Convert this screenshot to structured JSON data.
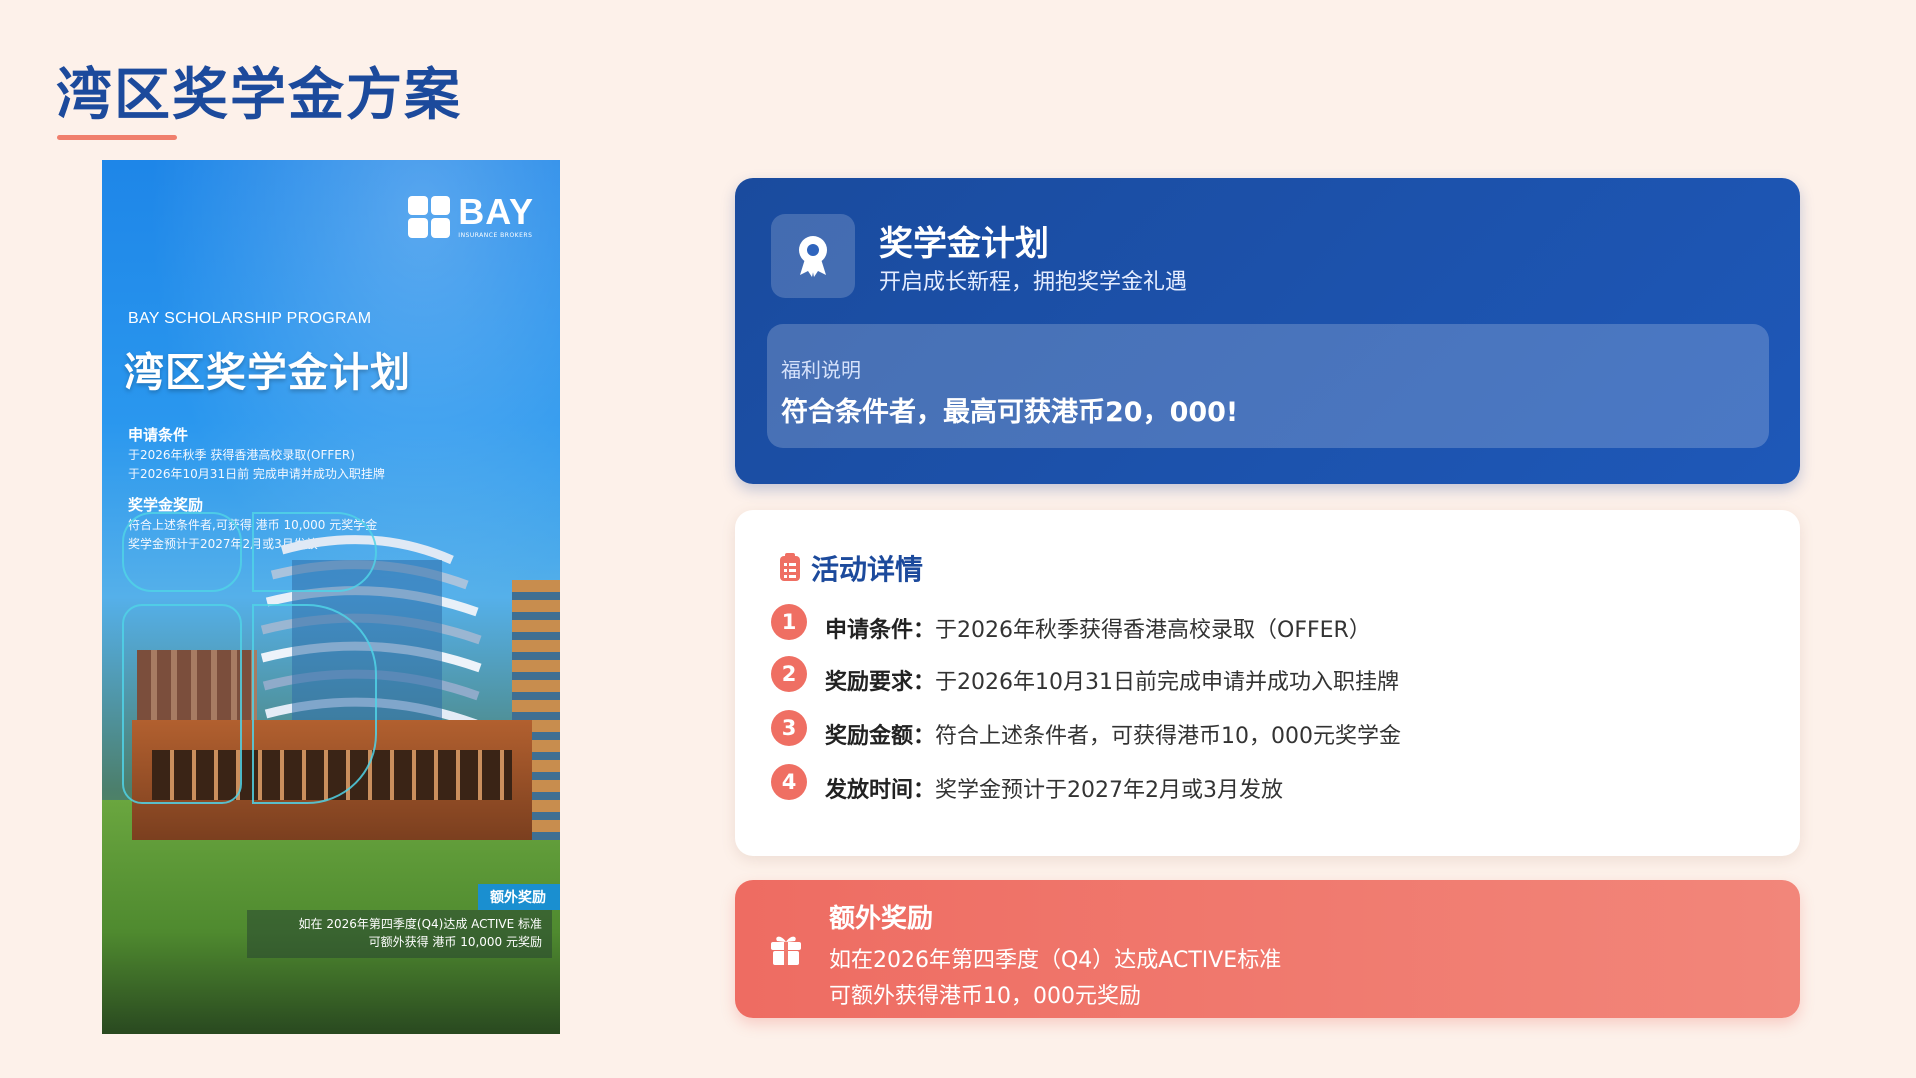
{
  "page": {
    "title": "湾区奖学金方案"
  },
  "poster": {
    "logo_name": "BAY",
    "logo_sub": "INSURANCE BROKERS",
    "en_title": "BAY SCHOLARSHIP PROGRAM",
    "cn_title": "湾区奖学金计划",
    "conditions_title": "申请条件",
    "conditions": [
      "于2026年秋季 获得香港高校录取(OFFER)",
      "于2026年10月31日前 完成申请并成功入职挂牌"
    ],
    "award_title": "奖学金奖励",
    "award_lines": [
      "符合上述条件者,可获得 港币 10,000 元奖学金",
      "奖学金预计于2027年2月或3月发放"
    ],
    "extra_tag": "额外奖励",
    "extra_lines": [
      "如在 2026年第四季度(Q4)达成 ACTIVE 标准",
      "可额外获得 港币 10,000 元奖励"
    ]
  },
  "plan_card": {
    "icon": "award-ribbon-icon",
    "title": "奖学金计划",
    "subtitle": "开启成长新程，拥抱奖学金礼遇",
    "benefit_label": "福利说明",
    "benefit_text": "符合条件者，最高可获港币20，000!"
  },
  "details_card": {
    "icon": "clipboard-icon",
    "title": "活动详情",
    "items": [
      {
        "num": "1",
        "label": "申请条件：",
        "text": "于2026年秋季获得香港高校录取（OFFER）"
      },
      {
        "num": "2",
        "label": "奖励要求：",
        "text": "于2026年10月31日前完成申请并成功入职挂牌"
      },
      {
        "num": "3",
        "label": "奖励金额：",
        "text": "符合上述条件者，可获得港币10，000元奖学金"
      },
      {
        "num": "4",
        "label": "发放时间：",
        "text": " 奖学金预计于2027年2月或3月发放"
      }
    ]
  },
  "extra_card": {
    "icon": "gift-icon",
    "title": "额外奖励",
    "lines": [
      "如在2026年第四季度（Q4）达成ACTIVE标准",
      "可额外获得港币10，000元奖励"
    ]
  },
  "colors": {
    "background": "#fdf1ea",
    "brand_blue": "#1c4a9c",
    "accent_coral": "#ef6f63"
  }
}
